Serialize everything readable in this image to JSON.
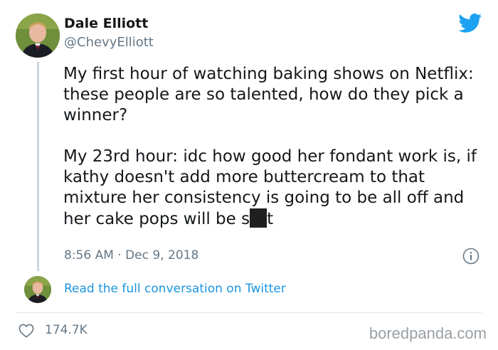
{
  "author": {
    "display_name": "Dale Elliott",
    "handle": "@ChevyElliott",
    "avatar_icon": "profile-photo"
  },
  "brand": {
    "icon": "twitter-bird-icon",
    "color": "#1da1f2"
  },
  "tweet": {
    "paragraph1": "My first hour of watching baking shows on Netflix: these people are so talented, how do they pick a winner?",
    "paragraph2_before_redaction": "My 23rd hour: idc how good her fondant work is, if kathy doesn't add more buttercream to that mixture her consistency is going to be all off and her cake pops will be s",
    "paragraph2_after_redaction": "t",
    "timestamp": "8:56 AM · Dec 9, 2018"
  },
  "footer": {
    "read_full_label": "Read the full conversation on Twitter",
    "like_count": "174.7K",
    "watermark": "boredpanda.com"
  },
  "colors": {
    "link": "#1b95e0",
    "muted": "#657786",
    "text": "#14171a"
  }
}
